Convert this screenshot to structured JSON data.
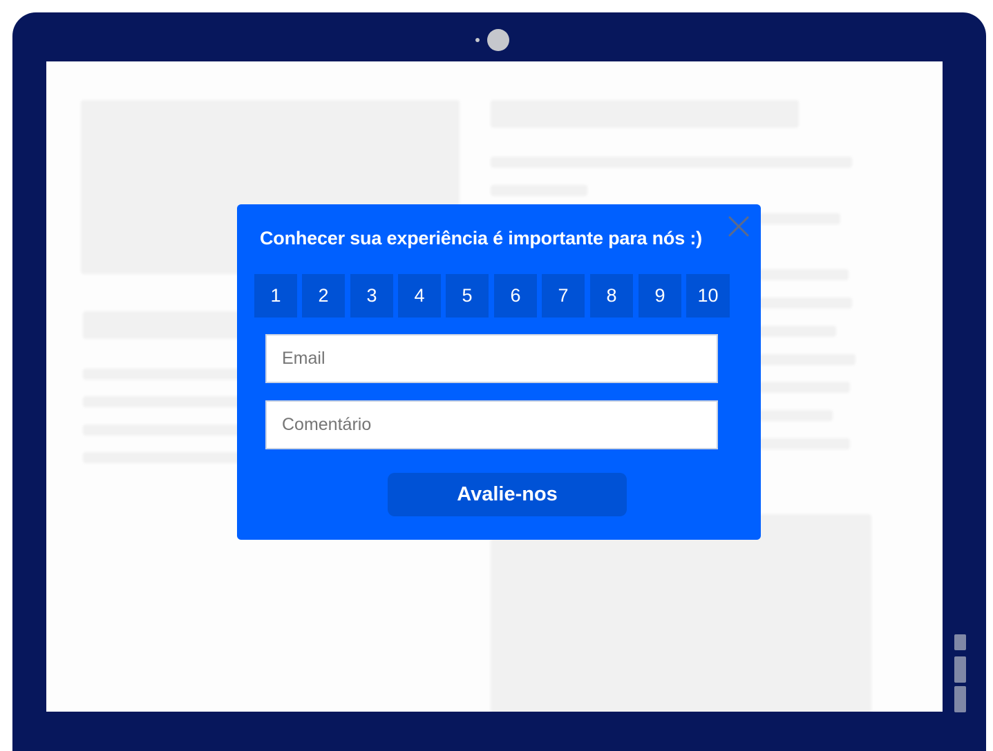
{
  "popup": {
    "title": "Conhecer sua experiência é importante para nós :)",
    "rating_options": [
      "1",
      "2",
      "3",
      "4",
      "5",
      "6",
      "7",
      "8",
      "9",
      "10"
    ],
    "email_placeholder": "Email",
    "comment_placeholder": "Comentário",
    "submit_label": "Avalie-nos",
    "close_icon": "close-icon"
  },
  "colors": {
    "device_frame": "#07175c",
    "modal_background": "#0060ff",
    "rating_button": "#0052d6",
    "submit_button": "#0052d6",
    "screen_background": "#fdfdfd",
    "placeholder_blocks": "#f1f1f1"
  }
}
